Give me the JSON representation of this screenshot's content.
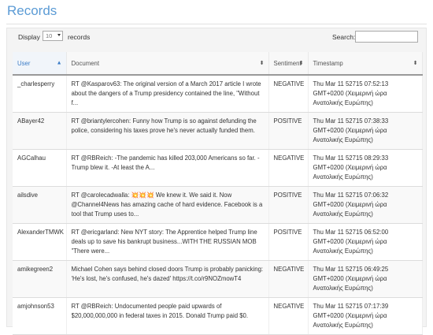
{
  "page": {
    "title": "Records"
  },
  "controls": {
    "display_label": "Display",
    "page_length": "10",
    "records_label": "records",
    "search_label": "Search:",
    "search_value": ""
  },
  "table": {
    "columns": [
      {
        "label": "User",
        "sort": "ascending"
      },
      {
        "label": "Document",
        "sort": "both"
      },
      {
        "label": "Sentiment",
        "sort": "both"
      },
      {
        "label": "Timestamp",
        "sort": "both"
      }
    ],
    "rows": [
      {
        "user": "_charlesperry",
        "document": "RT @Kasparov63: The original version of a March 2017 article I wrote about the dangers of a Trump presidency contained the line, \"Without f...",
        "sentiment": "NEGATIVE",
        "timestamp": "Thu Mar 11 52715 07:52:13 GMT+0200 (Χειμερινή ώρα Ανατολικής Ευρώπης)"
      },
      {
        "user": "ABayer42",
        "document": "RT @briantylercohen: Funny how Trump is so against defunding the police, considering his taxes prove he's never actually funded them.",
        "sentiment": "POSITIVE",
        "timestamp": "Thu Mar 11 52715 07:38:33 GMT+0200 (Χειμερινή ώρα Ανατολικής Ευρώπης)"
      },
      {
        "user": "AGCalhau",
        "document": "RT @RBReich: -The pandemic has killed 203,000 Americans so far. -Trump blew it. -At least the A...",
        "sentiment": "NEGATIVE",
        "timestamp": "Thu Mar 11 52715 08:29:33 GMT+0200 (Χειμερινή ώρα Ανατολικής Ευρώπης)"
      },
      {
        "user": "ailsdive",
        "document_prefix": "RT @carolecadwalla: ",
        "document_emoji": "💥💥💥",
        "document_suffix": " We knew it. We said it. Now @Channel4News has amazing cache of hard evidence. Facebook is a tool that Trump uses to...",
        "sentiment": "POSITIVE",
        "timestamp": "Thu Mar 11 52715 07:06:32 GMT+0200 (Χειμερινή ώρα Ανατολικής Ευρώπης)"
      },
      {
        "user": "AlexanderTMWK",
        "document": "RT @ericgarland: New NYT story: The Apprentice helped Trump line deals up to save his bankrupt business...WITH THE RUSSIAN MOB \"There were...",
        "sentiment": "POSITIVE",
        "timestamp": "Thu Mar 11 52715 06:52:00 GMT+0200 (Χειμερινή ώρα Ανατολικής Ευρώπης)"
      },
      {
        "user": "amikegreen2",
        "document": "Michael Cohen says behind closed doors Trump is probably panicking: 'He's lost, he's confused, he's dazed' https://t.co/r9NOZmowT4",
        "sentiment": "NEGATIVE",
        "timestamp": "Thu Mar 11 52715 06:49:25 GMT+0200 (Χειμερινή ώρα Ανατολικής Ευρώπης)"
      },
      {
        "user": "amjohnson53",
        "document": "RT @RBReich: Undocumented people paid upwards of $20,000,000,000 in federal taxes in 2015. Donald Trump paid $0.",
        "sentiment": "NEGATIVE",
        "timestamp": "Thu Mar 11 52715 07:17:39 GMT+0200 (Χειμερινή ώρα Ανατολικής Ευρώπης)"
      }
    ]
  }
}
